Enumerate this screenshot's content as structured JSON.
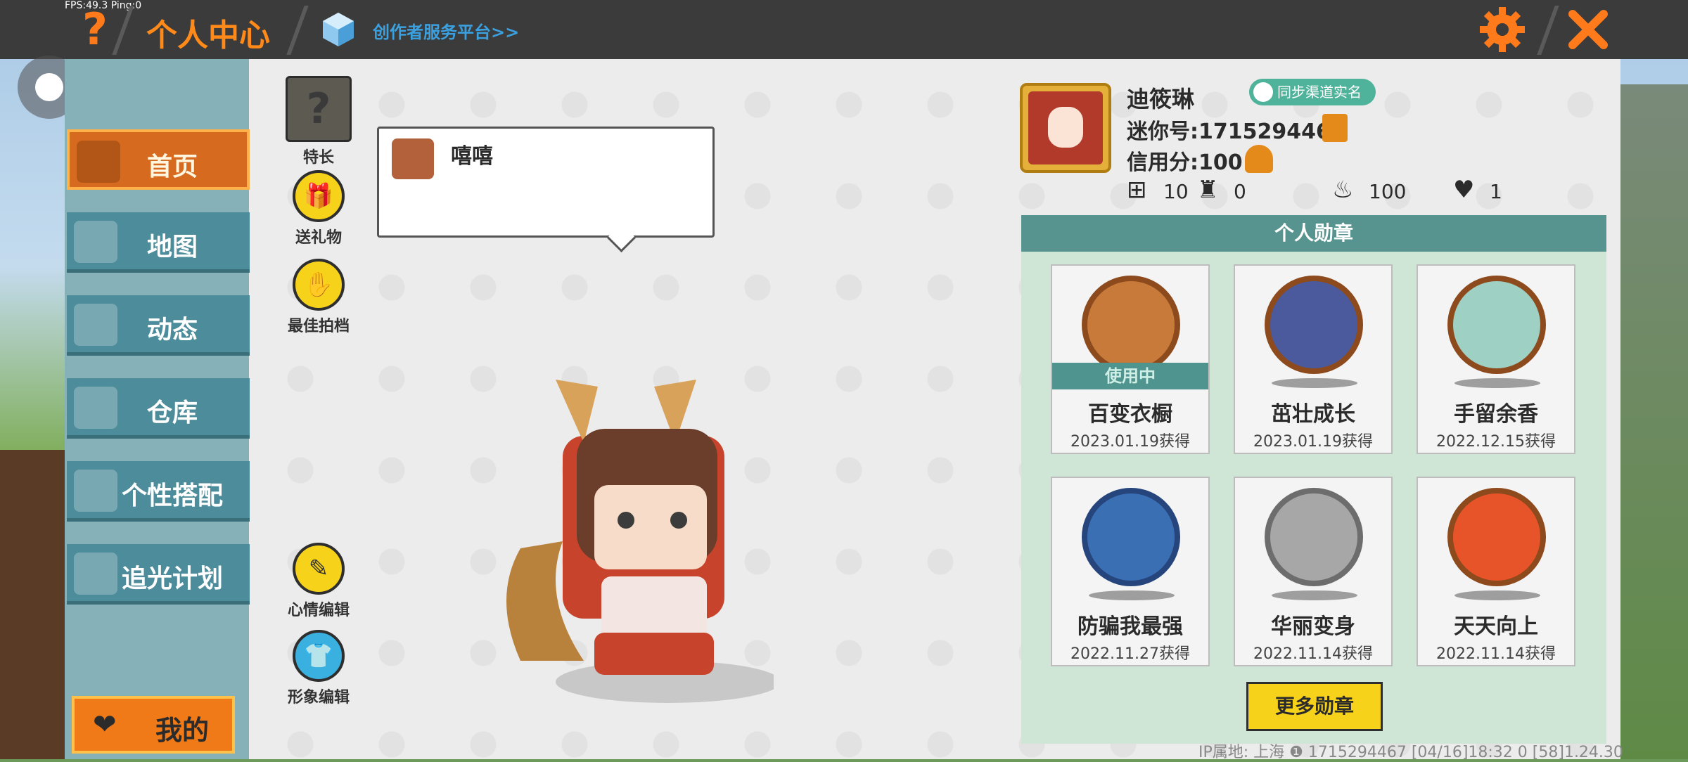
{
  "hud": {
    "fps": "FPS:49.3  Ping:0"
  },
  "header": {
    "help_symbol": "?",
    "title": "个人中心",
    "creator_link": "创作者服务平台>>",
    "close_symbol": "✕"
  },
  "sidebar": {
    "items": [
      {
        "label": "首页"
      },
      {
        "label": "地图"
      },
      {
        "label": "动态"
      },
      {
        "label": "仓库"
      },
      {
        "label": "个性搭配"
      },
      {
        "label": "追光计划"
      }
    ],
    "mine_label": "我的"
  },
  "tools": {
    "skill_label": "特长",
    "gift_label": "送礼物",
    "partner_label": "最佳拍档",
    "mood_label": "心情编辑",
    "avatar_edit_label": "形象编辑"
  },
  "bubble": {
    "text": "嘻嘻"
  },
  "profile": {
    "name": "迪筱琳",
    "sync_label": "同步渠道实名",
    "mini_id": "迷你号:1715294467",
    "credit": "信用分:100",
    "stats": {
      "bookmark": "10",
      "fans": "0",
      "heat": "100",
      "likes": "1"
    }
  },
  "medals": {
    "header": "个人勋章",
    "in_use_label": "使用中",
    "items": [
      {
        "name": "百变衣橱",
        "date": "2023.01.19获得"
      },
      {
        "name": "茁壮成长",
        "date": "2023.01.19获得"
      },
      {
        "name": "手留余香",
        "date": "2022.12.15获得"
      },
      {
        "name": "防骗我最强",
        "date": "2022.11.27获得"
      },
      {
        "name": "华丽变身",
        "date": "2022.11.14获得"
      },
      {
        "name": "天天向上",
        "date": "2022.11.14获得"
      }
    ],
    "more_label": "更多勋章"
  },
  "footer": {
    "info": "IP属地: 上海 ❶  1715294467    [04/16]18:32 0  [58]1.24.30"
  },
  "colors": {
    "accent": "#ff8a1a",
    "nav": "#4d8c9a",
    "nav_active": "#d66a1e",
    "medal_header": "#57948f",
    "button_yellow": "#f7d21a"
  }
}
